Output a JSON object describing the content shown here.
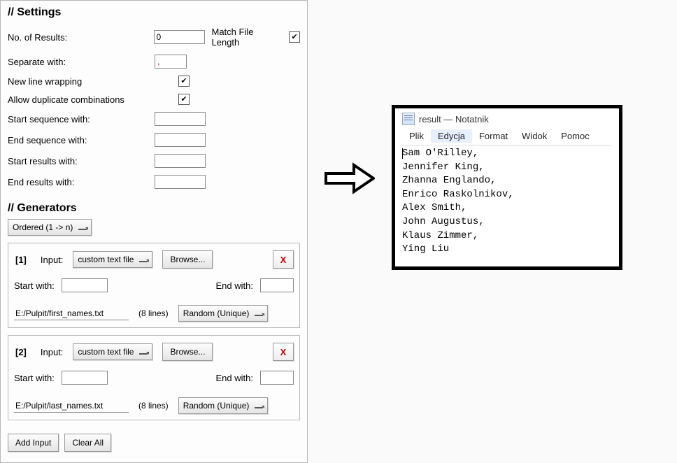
{
  "settings": {
    "title": "// Settings",
    "no_results_label": "No. of Results:",
    "no_results_value": "0",
    "match_file_len_label": "Match File Length",
    "match_file_len_checked": true,
    "separate_label": "Separate with:",
    "separate_value": ",",
    "newline_label": "New line wrapping",
    "newline_checked": true,
    "dup_label": "Allow duplicate combinations",
    "dup_checked": true,
    "start_seq_label": "Start sequence with:",
    "start_seq_value": "",
    "end_seq_label": "End sequence with:",
    "end_seq_value": "",
    "start_res_label": "Start results with:",
    "start_res_value": "",
    "end_res_label": "End results with:",
    "end_res_value": ""
  },
  "generators": {
    "title": "// Generators",
    "order_mode": "Ordered (1 -> n)",
    "add_input_label": "Add Input",
    "clear_all_label": "Clear All",
    "items": [
      {
        "idx": "[1]",
        "input_label": "Input:",
        "type": "custom text file",
        "browse": "Browse...",
        "delete": "X",
        "start_label": "Start with:",
        "start_value": "",
        "end_label": "End with:",
        "end_value": "",
        "path": "E:/Pulpit/first_names.txt",
        "lines": "(8 lines)",
        "mode": "Random (Unique)"
      },
      {
        "idx": "[2]",
        "input_label": "Input:",
        "type": "custom text file",
        "browse": "Browse...",
        "delete": "X",
        "start_label": "Start with:",
        "start_value": "",
        "end_label": "End with:",
        "end_value": "",
        "path": "E:/Pulpit/last_names.txt",
        "lines": "(8 lines)",
        "mode": "Random (Unique)"
      }
    ]
  },
  "notepad": {
    "title": "result — Notatnik",
    "menu": [
      "Plik",
      "Edycja",
      "Format",
      "Widok",
      "Pomoc"
    ],
    "selected_menu_idx": 1,
    "lines": [
      "Sam O'Rilley,",
      "Jennifer King,",
      "Zhanna Englando,",
      "Enrico Raskolnikov,",
      "Alex Smith,",
      "John Augustus,",
      "Klaus Zimmer,",
      "Ying Liu"
    ]
  }
}
